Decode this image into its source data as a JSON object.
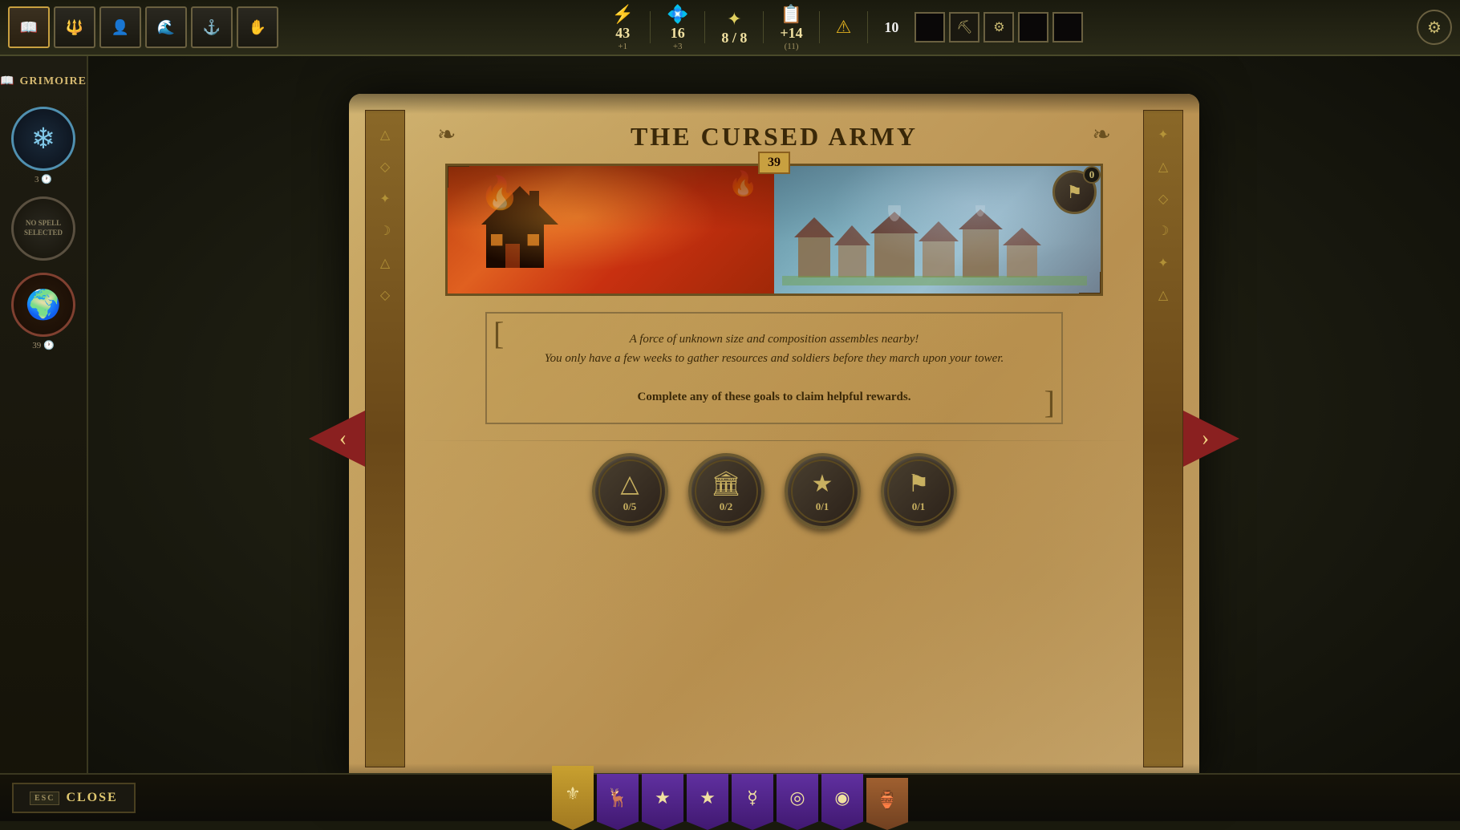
{
  "app": {
    "title": "Grimoire"
  },
  "top_bar": {
    "resources": [
      {
        "icon": "⚡",
        "value": "43",
        "sub": "+1",
        "name": "energy"
      },
      {
        "icon": "💎",
        "value": "16",
        "sub": "+3",
        "name": "crystals"
      },
      {
        "icon": "⭐",
        "value": "8 / 8",
        "sub": "",
        "name": "stars"
      },
      {
        "icon": "📜",
        "value": "+14",
        "sub": "(11)",
        "name": "scrolls"
      },
      {
        "icon": "⚠",
        "value": "",
        "sub": "",
        "name": "warning"
      },
      {
        "icon": "",
        "value": "10",
        "sub": "",
        "name": "score"
      }
    ],
    "settings_icon": "⚙"
  },
  "sidebar": {
    "title": "Grimoire",
    "book_icon": "📖",
    "spells": [
      {
        "name": "ice-spell",
        "type": "ice",
        "icon": "❄",
        "count": "3",
        "label": ""
      },
      {
        "name": "no-spell",
        "type": "empty",
        "text": "No Spell\nSelected",
        "label": ""
      },
      {
        "name": "world-spell",
        "type": "world",
        "icon": "🌍",
        "count": "39",
        "label": ""
      }
    ]
  },
  "grimoire": {
    "title": "The Cursed Army",
    "image_number": "39",
    "medal_count": "0",
    "description_line1": "A force of unknown size and composition assembles nearby!",
    "description_line2": "You only have a few weeks to gather resources and soldiers before they march upon your tower.",
    "description_line3": "Complete any of these goals to claim helpful rewards.",
    "goals": [
      {
        "icon": "△",
        "progress": "0/5",
        "name": "mountain-goal"
      },
      {
        "icon": "🏛",
        "progress": "0/2",
        "name": "building-goal"
      },
      {
        "icon": "★",
        "progress": "0/1",
        "name": "star-goal"
      },
      {
        "icon": "⚑",
        "progress": "0/1",
        "name": "flag-goal"
      }
    ]
  },
  "navigation": {
    "arrow_left": "‹",
    "arrow_right": "›"
  },
  "bottom_bar": {
    "close_label": "Close",
    "close_esc": "Esc",
    "banners": [
      {
        "color": "gold",
        "icon": "⚜",
        "name": "banner-emblem"
      },
      {
        "color": "purple",
        "icon": "🦌",
        "name": "banner-deer"
      },
      {
        "color": "purple",
        "icon": "★",
        "name": "banner-star1"
      },
      {
        "color": "purple",
        "icon": "★",
        "name": "banner-star2"
      },
      {
        "color": "purple",
        "icon": "☿",
        "name": "banner-rune1"
      },
      {
        "color": "purple",
        "icon": "◎",
        "name": "banner-rune2"
      },
      {
        "color": "purple",
        "icon": "◉",
        "name": "banner-rune3"
      },
      {
        "color": "bronze",
        "icon": "🏺",
        "name": "banner-pot"
      }
    ]
  }
}
